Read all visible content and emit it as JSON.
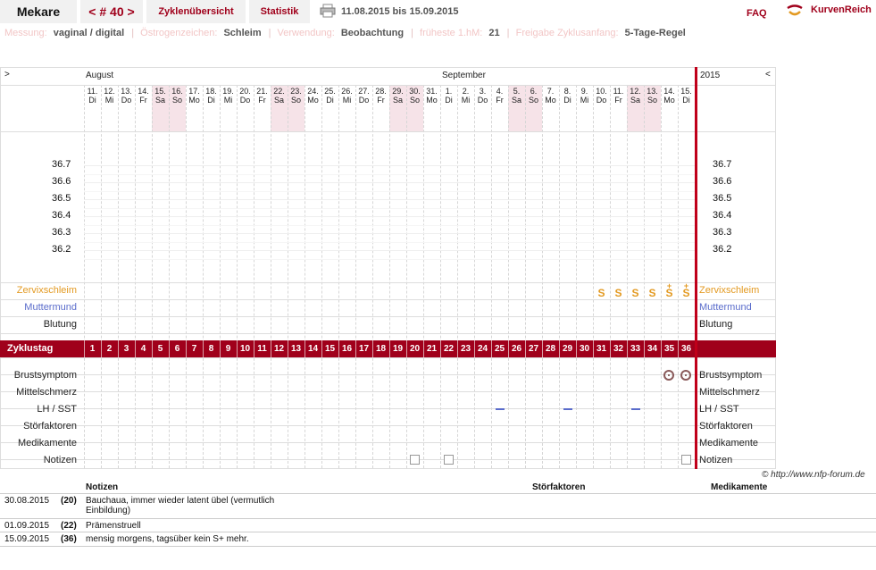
{
  "header": {
    "brand": "Mekare",
    "cycle_tab": "< # 40 >",
    "tab_overview": "Zyklenübersicht",
    "tab_stats": "Statistik",
    "date_range": "11.08.2015 bis 15.09.2015",
    "faq": "FAQ",
    "logo_text": "KurvenReich",
    "print_icon": "printer-icon",
    "logo_icon": "kurvenreich-logo-icon"
  },
  "settings": {
    "messung_label": "Messung:",
    "messung_value": "vaginal / digital",
    "oestrogen_label": "Östrogenzeichen:",
    "oestrogen_value": "Schleim",
    "verwendung_label": "Verwendung:",
    "verwendung_value": "Beobachtung",
    "fruehe_label": "früheste 1.hM:",
    "fruehe_value": "21",
    "freigabe_label": "Freigabe Zyklusanfang:",
    "freigabe_value": "5-Tage-Regel"
  },
  "chart": {
    "nav_left": ">",
    "nav_right": "<",
    "month_august": "August",
    "month_september": "September",
    "year": "2015",
    "days": [
      {
        "d": "11.",
        "w": "Di",
        "we": false
      },
      {
        "d": "12.",
        "w": "Mi",
        "we": false
      },
      {
        "d": "13.",
        "w": "Do",
        "we": false
      },
      {
        "d": "14.",
        "w": "Fr",
        "we": false
      },
      {
        "d": "15.",
        "w": "Sa",
        "we": true
      },
      {
        "d": "16.",
        "w": "So",
        "we": true
      },
      {
        "d": "17.",
        "w": "Mo",
        "we": false
      },
      {
        "d": "18.",
        "w": "Di",
        "we": false
      },
      {
        "d": "19.",
        "w": "Mi",
        "we": false
      },
      {
        "d": "20.",
        "w": "Do",
        "we": false
      },
      {
        "d": "21.",
        "w": "Fr",
        "we": false
      },
      {
        "d": "22.",
        "w": "Sa",
        "we": true
      },
      {
        "d": "23.",
        "w": "So",
        "we": true
      },
      {
        "d": "24.",
        "w": "Mo",
        "we": false
      },
      {
        "d": "25.",
        "w": "Di",
        "we": false
      },
      {
        "d": "26.",
        "w": "Mi",
        "we": false
      },
      {
        "d": "27.",
        "w": "Do",
        "we": false
      },
      {
        "d": "28.",
        "w": "Fr",
        "we": false
      },
      {
        "d": "29.",
        "w": "Sa",
        "we": true
      },
      {
        "d": "30.",
        "w": "So",
        "we": true
      },
      {
        "d": "31.",
        "w": "Mo",
        "we": false
      },
      {
        "d": "1.",
        "w": "Di",
        "we": false
      },
      {
        "d": "2.",
        "w": "Mi",
        "we": false
      },
      {
        "d": "3.",
        "w": "Do",
        "we": false
      },
      {
        "d": "4.",
        "w": "Fr",
        "we": false
      },
      {
        "d": "5.",
        "w": "Sa",
        "we": true
      },
      {
        "d": "6.",
        "w": "So",
        "we": true
      },
      {
        "d": "7.",
        "w": "Mo",
        "we": false
      },
      {
        "d": "8.",
        "w": "Di",
        "we": false
      },
      {
        "d": "9.",
        "w": "Mi",
        "we": false
      },
      {
        "d": "10.",
        "w": "Do",
        "we": false
      },
      {
        "d": "11.",
        "w": "Fr",
        "we": false
      },
      {
        "d": "12.",
        "w": "Sa",
        "we": true
      },
      {
        "d": "13.",
        "w": "So",
        "we": true
      },
      {
        "d": "14.",
        "w": "Mo",
        "we": false
      },
      {
        "d": "15.",
        "w": "Di",
        "we": false
      }
    ],
    "temps": [
      "36.7",
      "36.6",
      "36.5",
      "36.4",
      "36.3",
      "36.2"
    ],
    "rows_top": [
      "Zervixschleim",
      "Muttermund",
      "Blutung"
    ],
    "zyklustag_label": "Zyklustag",
    "zyklustage": [
      "1",
      "2",
      "3",
      "4",
      "5",
      "6",
      "7",
      "8",
      "9",
      "10",
      "11",
      "12",
      "13",
      "14",
      "15",
      "16",
      "17",
      "18",
      "19",
      "20",
      "21",
      "22",
      "23",
      "24",
      "25",
      "26",
      "27",
      "28",
      "29",
      "30",
      "31",
      "32",
      "33",
      "34",
      "35",
      "36"
    ],
    "rows_bottom": [
      "Brustsymptom",
      "Mittelschmerz",
      "LH / SST",
      "Störfaktoren",
      "Medikamente",
      "Notizen"
    ],
    "mucus": [
      {
        "day": 31,
        "sym": "S",
        "plus": false
      },
      {
        "day": 32,
        "sym": "S",
        "plus": false
      },
      {
        "day": 33,
        "sym": "S",
        "plus": false
      },
      {
        "day": 34,
        "sym": "S",
        "plus": false
      },
      {
        "day": 35,
        "sym": "S",
        "plus": true
      },
      {
        "day": 36,
        "sym": "S",
        "plus": true
      }
    ],
    "lh_days": [
      25,
      29,
      33
    ],
    "breast_days": [
      35,
      36
    ],
    "note_days": [
      20,
      22,
      36
    ],
    "colors": {
      "accent": "#a0001b",
      "mucus": "#e39a22",
      "muttermund": "#5a6ccb",
      "weekend": "#f6e3e8",
      "cycle_line": "#c0001a"
    }
  },
  "notes": {
    "copyright": "© http://www.nfp-forum.de",
    "col_notizen": "Notizen",
    "col_stoer": "Störfaktoren",
    "col_medi": "Medikamente",
    "entries": [
      {
        "date": "30.08.2015",
        "cd": "(20)",
        "text": "Bauchaua, immer wieder latent übel (vermutlich Einbildung)"
      },
      {
        "date": "01.09.2015",
        "cd": "(22)",
        "text": "Prämenstruell"
      },
      {
        "date": "15.09.2015",
        "cd": "(36)",
        "text": "mensig morgens, tagsüber kein S+ mehr."
      }
    ]
  }
}
